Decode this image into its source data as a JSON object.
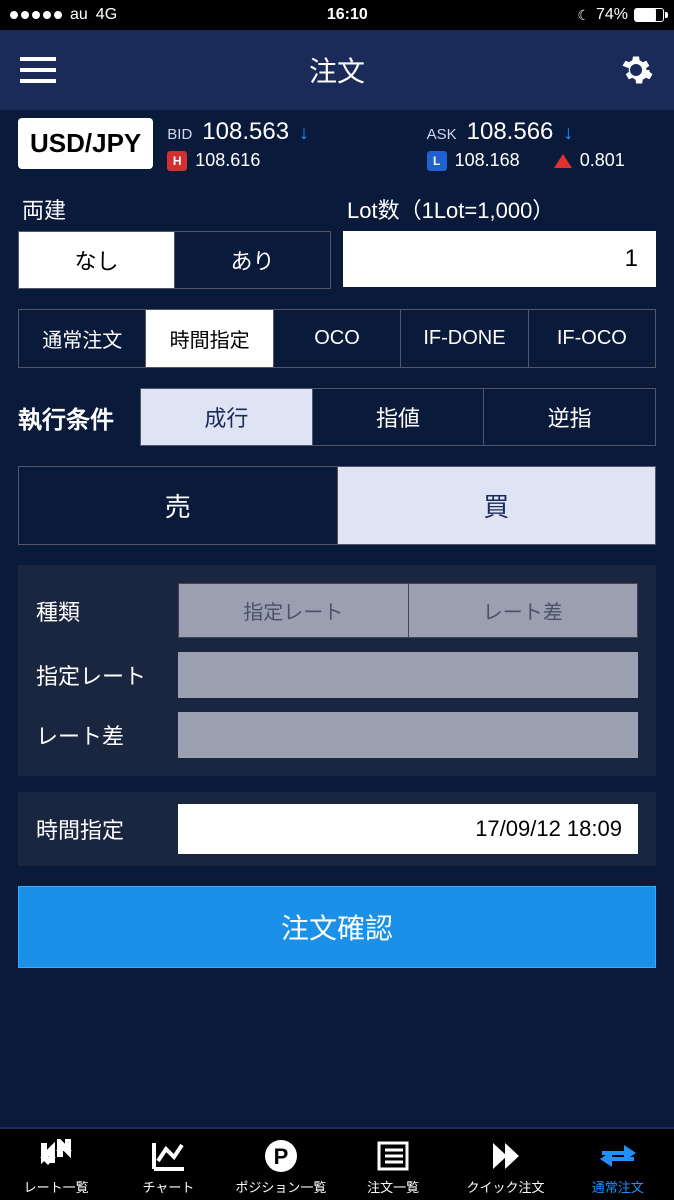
{
  "status": {
    "carrier": "au",
    "network": "4G",
    "time": "16:10",
    "battery": "74%"
  },
  "nav": {
    "title": "注文"
  },
  "pair": "USD/JPY",
  "prices": {
    "bid_label": "BID",
    "bid": "108.563",
    "ask_label": "ASK",
    "ask": "108.566",
    "high": "108.616",
    "low": "108.168",
    "spread": "0.801"
  },
  "hedge": {
    "label": "両建",
    "options": [
      "なし",
      "あり"
    ],
    "selected": 0
  },
  "lot": {
    "label": "Lot数（1Lot=1,000）",
    "value": "1"
  },
  "order_types": {
    "options": [
      "通常注文",
      "時間指定",
      "OCO",
      "IF-DONE",
      "IF-OCO"
    ],
    "selected": 1
  },
  "exec": {
    "label": "執行条件",
    "options": [
      "成行",
      "指値",
      "逆指"
    ],
    "selected": 0
  },
  "side": {
    "options": [
      "売",
      "買"
    ],
    "selected": 1
  },
  "detail": {
    "type_label": "種類",
    "type_options": [
      "指定レート",
      "レート差"
    ],
    "rate_label": "指定レート",
    "diff_label": "レート差"
  },
  "time": {
    "label": "時間指定",
    "value": "17/09/12 18:09"
  },
  "confirm": "注文確認",
  "tabs": {
    "items": [
      "レート一覧",
      "チャート",
      "ポジション一覧",
      "注文一覧",
      "クイック注文",
      "通常注文"
    ],
    "active": 5
  }
}
